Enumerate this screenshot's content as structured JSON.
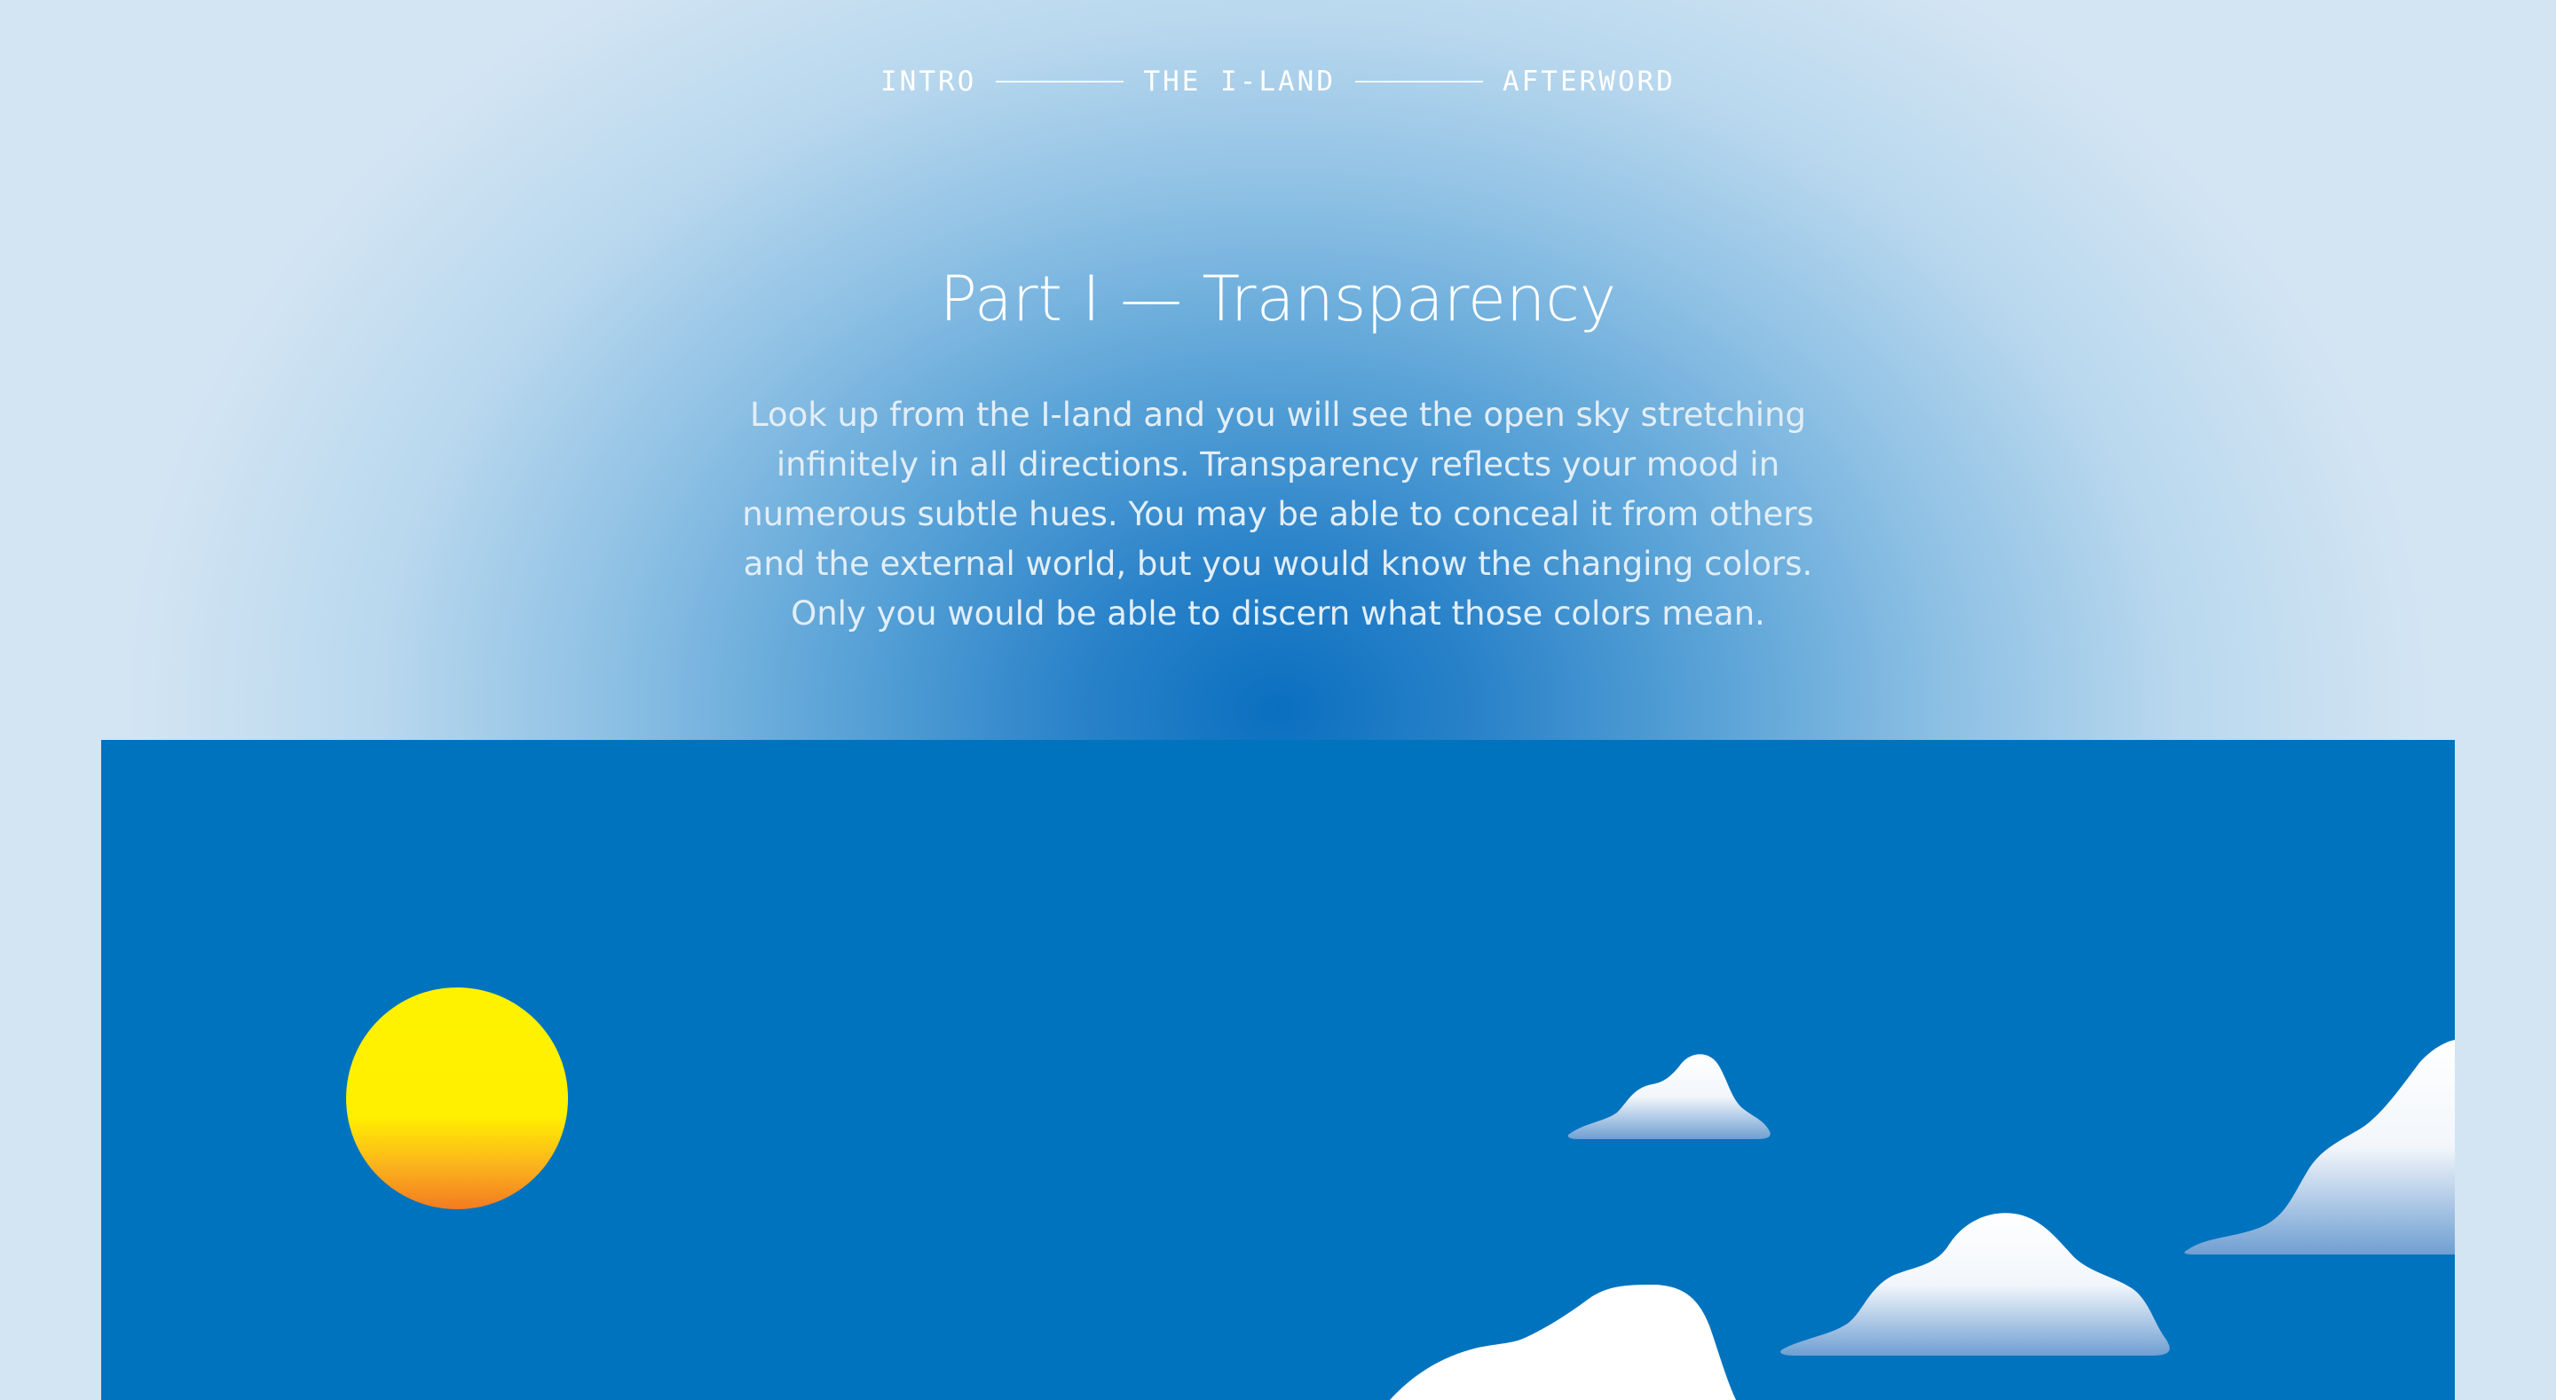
{
  "nav": {
    "items": [
      {
        "label": "INTRO"
      },
      {
        "label": "THE I-LAND"
      },
      {
        "label": "AFTERWORD"
      }
    ]
  },
  "section": {
    "title": "Part I — Transparency",
    "body": "Look up from the I-land and you will see the open sky stretching infinitely in all directions. Transparency reflects your mood in numerous subtle hues. You may be able to conceal it from others and the external world, but you would know the changing colors. Only you would be able to discern what those colors mean."
  },
  "scene": {
    "sky_color": "#0073BF",
    "sun_top_color": "#FFF200",
    "sun_bottom_color": "#F47B20",
    "cloud_color": "#FFFFFF"
  }
}
